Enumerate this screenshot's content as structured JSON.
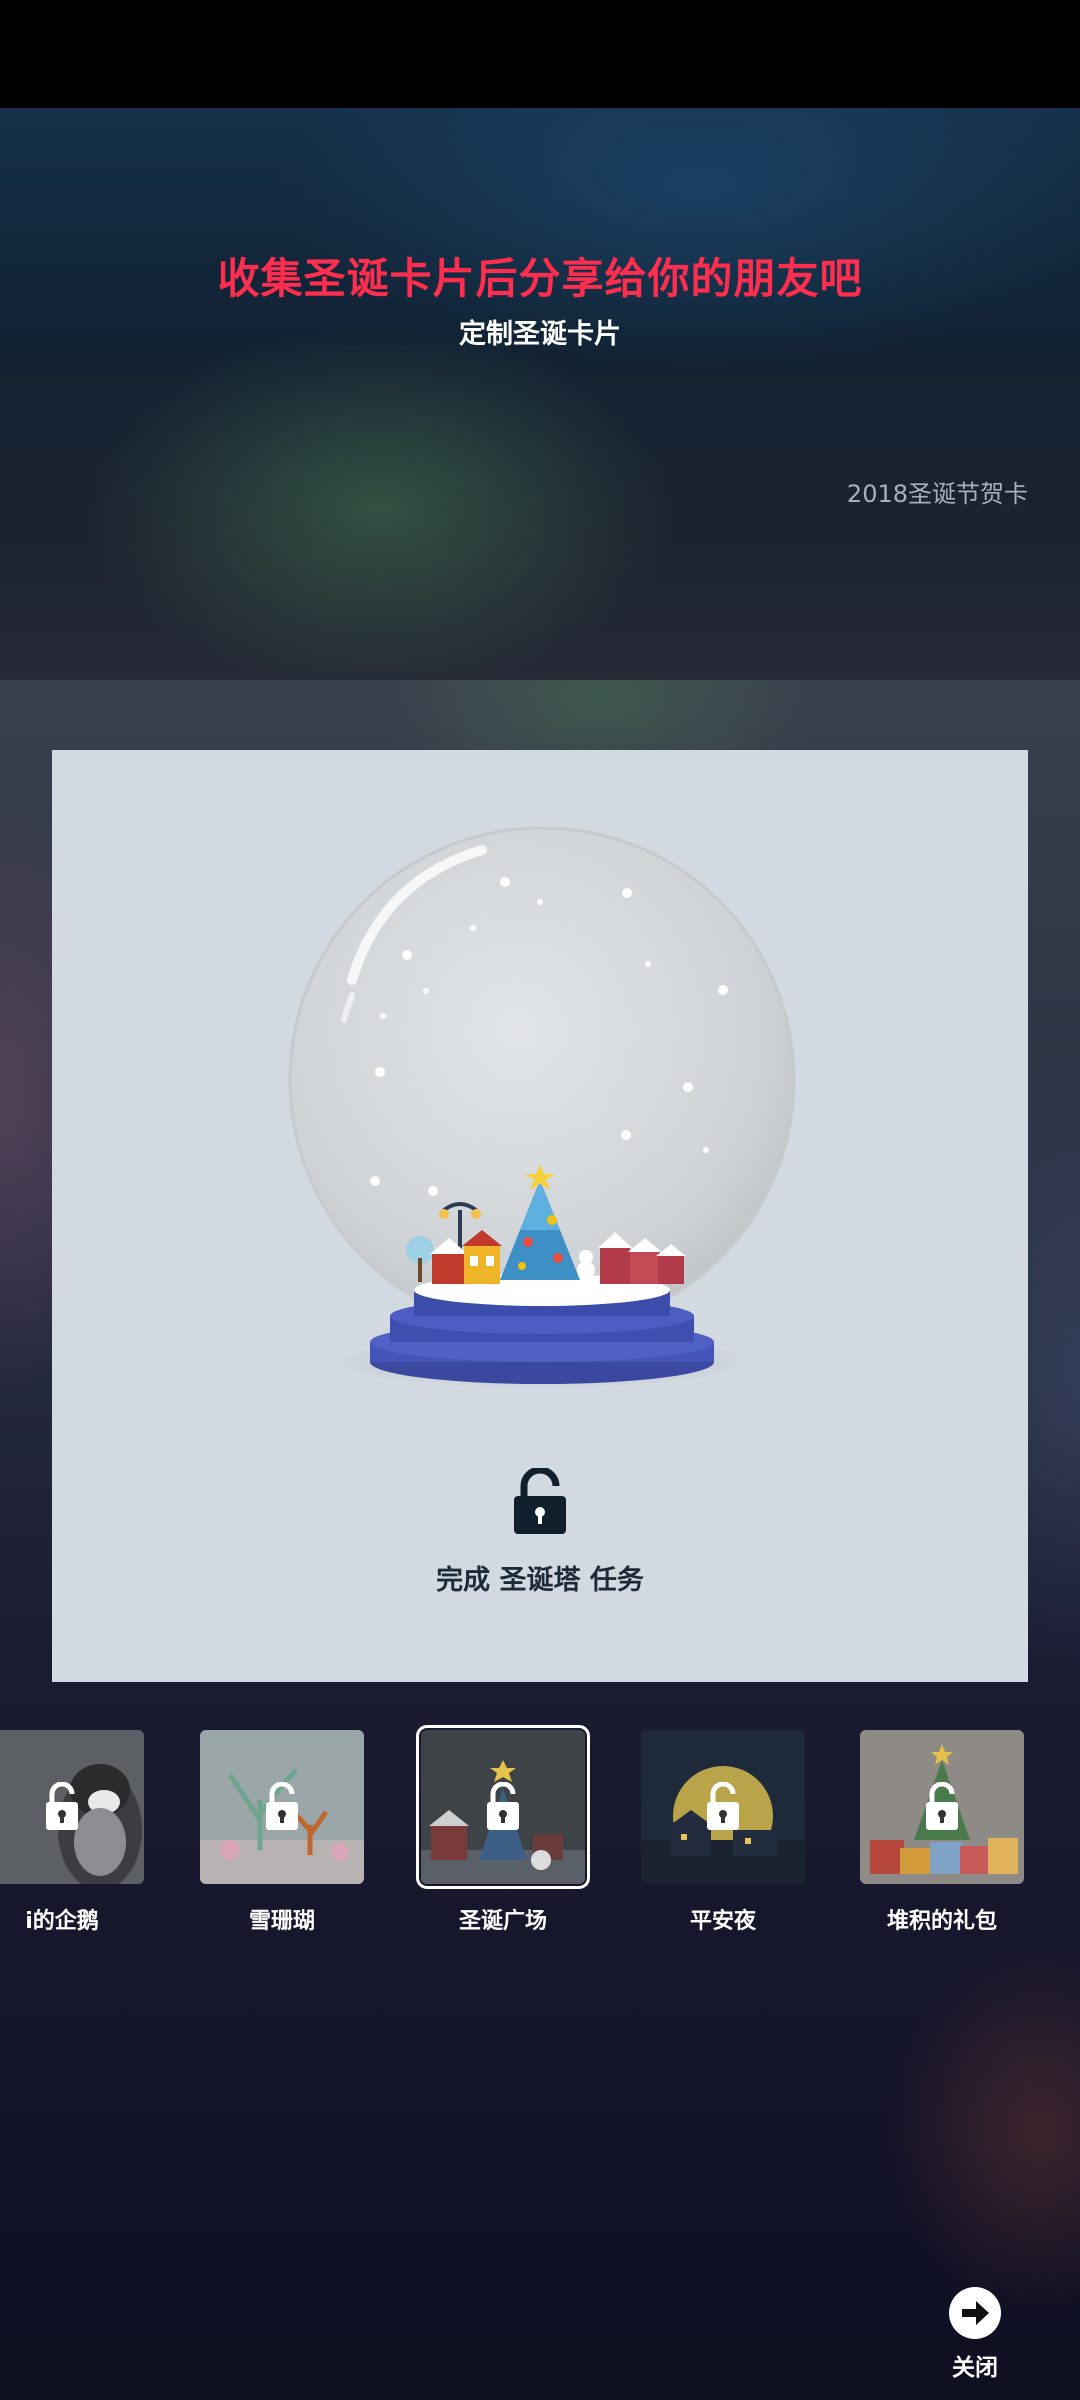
{
  "header": {
    "headline": "收集圣诞卡片后分享给你的朋友吧",
    "subheadline": "定制圣诞卡片",
    "year_label": "2018圣诞节贺卡"
  },
  "card": {
    "task_text": "完成 圣诞塔 任务",
    "lock_icon": "lock-icon"
  },
  "thumbnails": [
    {
      "label": "i的企鹅",
      "locked": true,
      "selected": false
    },
    {
      "label": "雪珊瑚",
      "locked": true,
      "selected": false
    },
    {
      "label": "圣诞广场",
      "locked": true,
      "selected": true
    },
    {
      "label": "平安夜",
      "locked": true,
      "selected": false
    },
    {
      "label": "堆积的礼包",
      "locked": true,
      "selected": false
    }
  ],
  "close": {
    "label": "关闭",
    "icon": "arrow-right-icon"
  },
  "colors": {
    "headline": "#ff2e4e",
    "card_bg": "#d3d9e1",
    "pedestal": "#3f4fb0"
  }
}
